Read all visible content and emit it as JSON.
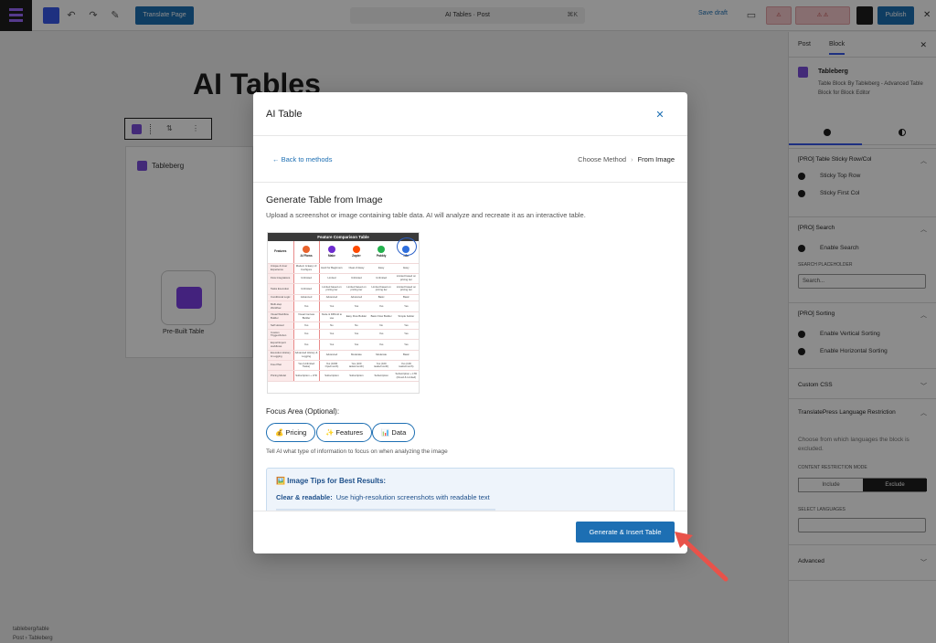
{
  "editor": {
    "translate_button": "Translate Page",
    "document_title": "AI Tables · Post",
    "document_shortcut": "⌘K",
    "save_draft": "Save draft",
    "publish": "Publish",
    "canvas_title": "AI Tables",
    "block_label": "Tableberg",
    "prebuilt_label": "Pre-Built Table",
    "footer_crumb": "tableberg/table",
    "footer_breadcrumb": "Post  ›  Tableberg"
  },
  "sidebar": {
    "tabs": [
      "Post",
      "Block"
    ],
    "block_name": "Tableberg",
    "block_description": "Table Block By Tableberg - Advanced Table Block for Block Editor",
    "sections": {
      "sticky_title": "[PRO] Table Sticky Row/Col",
      "sticky_top_row": "Sticky Top Row",
      "sticky_first_col": "Sticky First Col",
      "search_title": "[PRO] Search",
      "enable_search": "Enable Search",
      "search_label": "SEARCH PLACEHOLDER",
      "search_placeholder": "Search...",
      "sorting_title": "[PRO] Sorting",
      "enable_vertical_sorting": "Enable Vertical Sorting",
      "enable_horizontal_sorting": "Enable Horizontal Sorting",
      "custom_css": "Custom CSS",
      "translatepress_title": "TranslatePress Language Restriction",
      "translatepress_desc": "Choose from which languages the block is excluded.",
      "restriction_mode_label": "CONTENT RESTRICTION MODE",
      "include": "Include",
      "exclude": "Exclude",
      "select_languages_label": "SELECT LANGUAGES",
      "advanced": "Advanced"
    }
  },
  "modal": {
    "title": "AI Table",
    "back_link": "← Back to methods",
    "breadcrumb": [
      "Choose Method",
      "From Image"
    ],
    "heading": "Generate Table from Image",
    "subheading": "Upload a screenshot or image containing table data. AI will analyze and recreate it as an interactive table.",
    "focus_label": "Focus Area (Optional):",
    "focus_chips": [
      "💰 Pricing",
      "✨ Features",
      "📊 Data"
    ],
    "focus_help": "Tell AI what type of information to focus on when analyzing the image",
    "tips_title": "🖼️ Image Tips for Best Results:",
    "tips_item_bold": "Clear & readable:",
    "tips_item_text": "Use high-resolution screenshots with readable text",
    "generate_button": "Generate & Insert Table"
  },
  "preview": {
    "title": "Feature Comparison Table",
    "columns": [
      "Features",
      "AI Flows",
      "Make",
      "Zapier",
      "Pabbly",
      "n8n"
    ],
    "logo_colors": [
      "#e8622c",
      "#6d2ccf",
      "#ff4a00",
      "#23b14d",
      "#2f6fdd"
    ],
    "rows": [
      [
        "Unique & User Experience",
        "Modern & Easy UI Configure",
        "Hard for Beginners",
        "Clean & Easy",
        "Easy",
        "Easy"
      ],
      [
        "Flow Integrations",
        "Unlimited",
        "Limited",
        "Unlimited",
        "Unlimited",
        "Limited based on pricing tier"
      ],
      [
        "Tasks Execution",
        "Unlimited",
        "Limited based on pricing tier",
        "Limited based on pricing tier",
        "Limited based on pricing tier",
        "Limited based on pricing tier"
      ],
      [
        "Conditional Logic",
        "Advanced",
        "Advanced",
        "Advanced",
        "Basic",
        "Basic"
      ],
      [
        "Multi-step Workflow",
        "Yes",
        "Yes",
        "Yes",
        "Yes",
        "Yes"
      ],
      [
        "Visual Workflow Builder",
        "Visual Canvas Builder",
        "Node & Difficult to use",
        "Easy Flow Builder",
        "Basic Flow Builder",
        "Simple builder"
      ],
      [
        "Self Hosted",
        "Yes",
        "No",
        "No",
        "No",
        "Yes"
      ],
      [
        "Custom Trigger/Action",
        "Yes",
        "Yes",
        "Yes",
        "Yes",
        "Yes"
      ],
      [
        "Export/Import workflows",
        "Yes",
        "Yes",
        "Yes",
        "Yes",
        "Yes"
      ],
      [
        "Execution History & Logging",
        "Advanced History & Logging",
        "Advanced",
        "Moderate",
        "Moderate",
        "Basic"
      ],
      [
        "Free Plan",
        "Yes (Unlimited Tasks)",
        "Yes (1000 Ops/month)",
        "Yes (100 tasks/month)",
        "Yes (100 tasks/month)",
        "Yes (100 tasks/month)"
      ],
      [
        "Pricing Model",
        "Subscription + LTD",
        "Subscription",
        "Subscription",
        "Subscription",
        "Subscription + LTD (Cloud & Limited)"
      ]
    ]
  },
  "colors": {
    "accent": "#1d6fb3",
    "arrow": "#e8524a",
    "preview_highlight": "#e98a8a"
  }
}
